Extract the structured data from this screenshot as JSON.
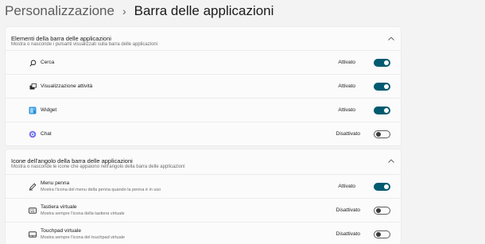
{
  "breadcrumb": {
    "parent": "Personalizzazione",
    "separator": "›",
    "current": "Barra delle applicazioni"
  },
  "colors": {
    "accent": "#005a70",
    "background": "#f3f3f3",
    "card": "#fbfbfb"
  },
  "sections": [
    {
      "title": "Elementi della barra delle applicazioni",
      "description": "Mostra o nasconde i pulsanti visualizzati sulla barra delle applicazioni",
      "expanded": true,
      "items": [
        {
          "label": "Cerca",
          "icon": "search-icon",
          "status": "Attivato",
          "on": true
        },
        {
          "label": "Visualizzazione attività",
          "icon": "task-view-icon",
          "status": "Attivato",
          "on": true
        },
        {
          "label": "Widget",
          "icon": "widgets-icon",
          "status": "Attivato",
          "on": true
        },
        {
          "label": "Chat",
          "icon": "chat-icon",
          "status": "Disattivato",
          "on": false
        }
      ]
    },
    {
      "title": "Icone dell'angolo della barra delle applicazioni",
      "description": "Mostra o nasconde le icone che appaiono nell'angolo della barra delle applicazioni",
      "expanded": true,
      "items": [
        {
          "label": "Menu penna",
          "sublabel": "Mostra l'icona del menu della penna quando la penna è in uso",
          "icon": "pen-icon",
          "status": "Attivato",
          "on": true
        },
        {
          "label": "Tastiera virtuale",
          "sublabel": "Mostra sempre l'icona della tastiera virtuale",
          "icon": "keyboard-icon",
          "status": "Disattivato",
          "on": false
        },
        {
          "label": "Touchpad virtuale",
          "sublabel": "Mostra sempre l'icona del touchpad virtuale",
          "icon": "touchpad-icon",
          "status": "Disattivato",
          "on": false
        }
      ]
    }
  ]
}
